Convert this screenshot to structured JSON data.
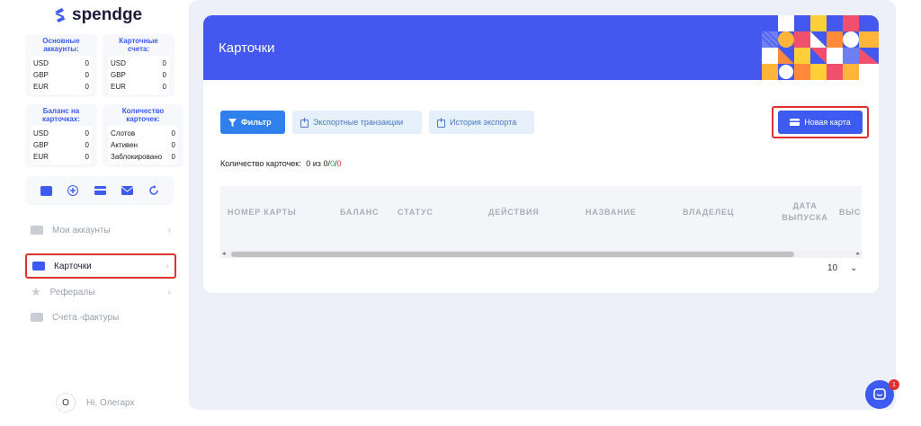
{
  "brand": {
    "name": "spendge"
  },
  "sidebar": {
    "boxes": [
      {
        "title": "Основные аккаунты:",
        "rows": [
          [
            "USD",
            "0"
          ],
          [
            "GBP",
            "0"
          ],
          [
            "EUR",
            "0"
          ]
        ]
      },
      {
        "title": "Карточные счета:",
        "rows": [
          [
            "USD",
            "0"
          ],
          [
            "GBP",
            "0"
          ],
          [
            "EUR",
            "0"
          ]
        ]
      },
      {
        "title": "Баланс на карточках:",
        "rows": [
          [
            "USD",
            "0"
          ],
          [
            "GBP",
            "0"
          ],
          [
            "EUR",
            "0"
          ]
        ]
      },
      {
        "title": "Количество карточек:",
        "rows": [
          [
            "Слотов",
            "0"
          ],
          [
            "Активен",
            "0"
          ],
          [
            "Заблокировано",
            "0"
          ]
        ]
      }
    ],
    "quick_actions": [
      "wallet-icon",
      "plus-icon",
      "card-icon",
      "mail-icon",
      "refresh-icon"
    ],
    "nav": [
      {
        "label": "Мои аккаунты",
        "icon": "accounts-icon"
      },
      {
        "label": "Карточки",
        "icon": "card-icon"
      },
      {
        "label": "Рефералы",
        "icon": "star-icon"
      },
      {
        "label": "Счета -фактуры",
        "icon": "invoice-icon"
      }
    ],
    "user": {
      "avatar": "O",
      "greeting": "Hi, Олегарх"
    }
  },
  "main": {
    "title": "Карточки",
    "toolbar": {
      "filter": "Фильтр",
      "export": "Экспортные транзакции",
      "history": "История экспорта",
      "new_card": "Новая карта"
    },
    "count": {
      "label": "Количество карточек:",
      "value": "0 из",
      "a": "0",
      "sep1": "/",
      "b": "0",
      "sep2": "/",
      "c": "0"
    },
    "table": {
      "columns": [
        "НОМЕР КАРТЫ",
        "БАЛАНС",
        "СТАТУС",
        "ДЕЙСТВИЯ",
        "НАЗВАНИЕ",
        "ВЛАДЕЛЕЦ",
        "ДАТА ВЫПУСКА",
        "ВЫС"
      ]
    },
    "per_page": "10"
  },
  "chat": {
    "badge": "1"
  },
  "colors": {
    "accent": "#3d5af1",
    "banner": "#4458ef",
    "highlight": "#e03030"
  }
}
